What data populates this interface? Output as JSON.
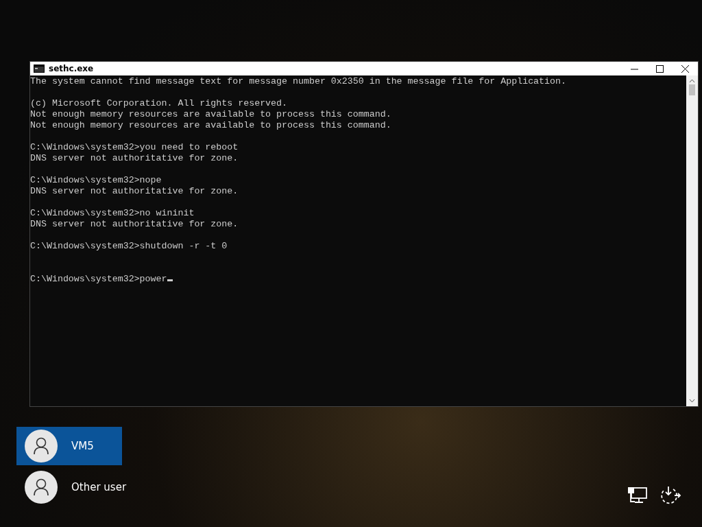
{
  "window": {
    "title": "sethc.exe"
  },
  "console": {
    "blocks": [
      {
        "kind": "output",
        "lines": [
          "The system cannot find message text for message number 0x2350 in the message file for Application."
        ]
      },
      {
        "kind": "output",
        "lines": [
          "(c) Microsoft Corporation. All rights reserved.",
          "Not enough memory resources are available to process this command.",
          "Not enough memory resources are available to process this command."
        ]
      },
      {
        "kind": "output",
        "lines": [
          "C:\\Windows\\system32>you need to reboot",
          "DNS server not authoritative for zone."
        ]
      },
      {
        "kind": "output",
        "lines": [
          "C:\\Windows\\system32>nope",
          "DNS server not authoritative for zone."
        ]
      },
      {
        "kind": "output",
        "lines": [
          "C:\\Windows\\system32>no wininit",
          "DNS server not authoritative for zone."
        ]
      },
      {
        "kind": "output",
        "lines": [
          "C:\\Windows\\system32>shutdown -r -t 0"
        ]
      },
      {
        "kind": "input",
        "lines": [
          "C:\\Windows\\system32>power"
        ]
      }
    ]
  },
  "users": [
    {
      "name": "VM5",
      "selected": true
    },
    {
      "name": "Other user",
      "selected": false
    }
  ]
}
